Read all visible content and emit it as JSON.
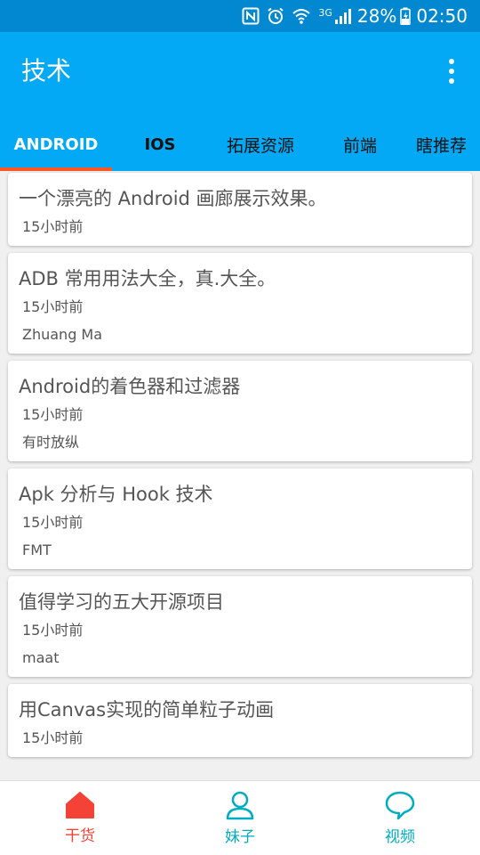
{
  "status_bar": {
    "signal_label": "3G",
    "battery_percent": "28%",
    "time": "02:50",
    "icons": [
      "nfc-icon",
      "alarm-icon",
      "wifi-icon",
      "cell-signal-icon",
      "battery-charging-icon"
    ]
  },
  "app_bar": {
    "title": "技术",
    "overflow_icon": "more-vert-icon"
  },
  "tabs": [
    {
      "label": "ANDROID",
      "active": true
    },
    {
      "label": "IOS",
      "active": false
    },
    {
      "label": "拓展资源",
      "active": false
    },
    {
      "label": "前端",
      "active": false
    },
    {
      "label": "瞎推荐",
      "active": false
    }
  ],
  "articles": [
    {
      "title": "一个漂亮的 Android 画廊展示效果。",
      "time": "15小时前",
      "author": ""
    },
    {
      "title": "ADB 常用用法大全，真.大全。",
      "time": "15小时前",
      "author": "Zhuang Ma"
    },
    {
      "title": "Android的着色器和过滤器",
      "time": "15小时前",
      "author": "有时放纵"
    },
    {
      "title": "Apk 分析与 Hook 技术",
      "time": "15小时前",
      "author": "FMT"
    },
    {
      "title": "值得学习的五大开源项目",
      "time": "15小时前",
      "author": "maat"
    },
    {
      "title": "用Canvas实现的简单粒子动画",
      "time": "15小时前",
      "author": ""
    }
  ],
  "bottom_nav": [
    {
      "label": "干货",
      "icon": "home-icon",
      "active": true
    },
    {
      "label": "妹子",
      "icon": "person-icon",
      "active": false
    },
    {
      "label": "视频",
      "icon": "chat-bubble-icon",
      "active": false
    }
  ],
  "colors": {
    "status_bar": "#0288d1",
    "primary": "#03a9f4",
    "tab_indicator": "#ff5722",
    "nav_active": "#f44336",
    "nav_inactive": "#00acc1"
  }
}
